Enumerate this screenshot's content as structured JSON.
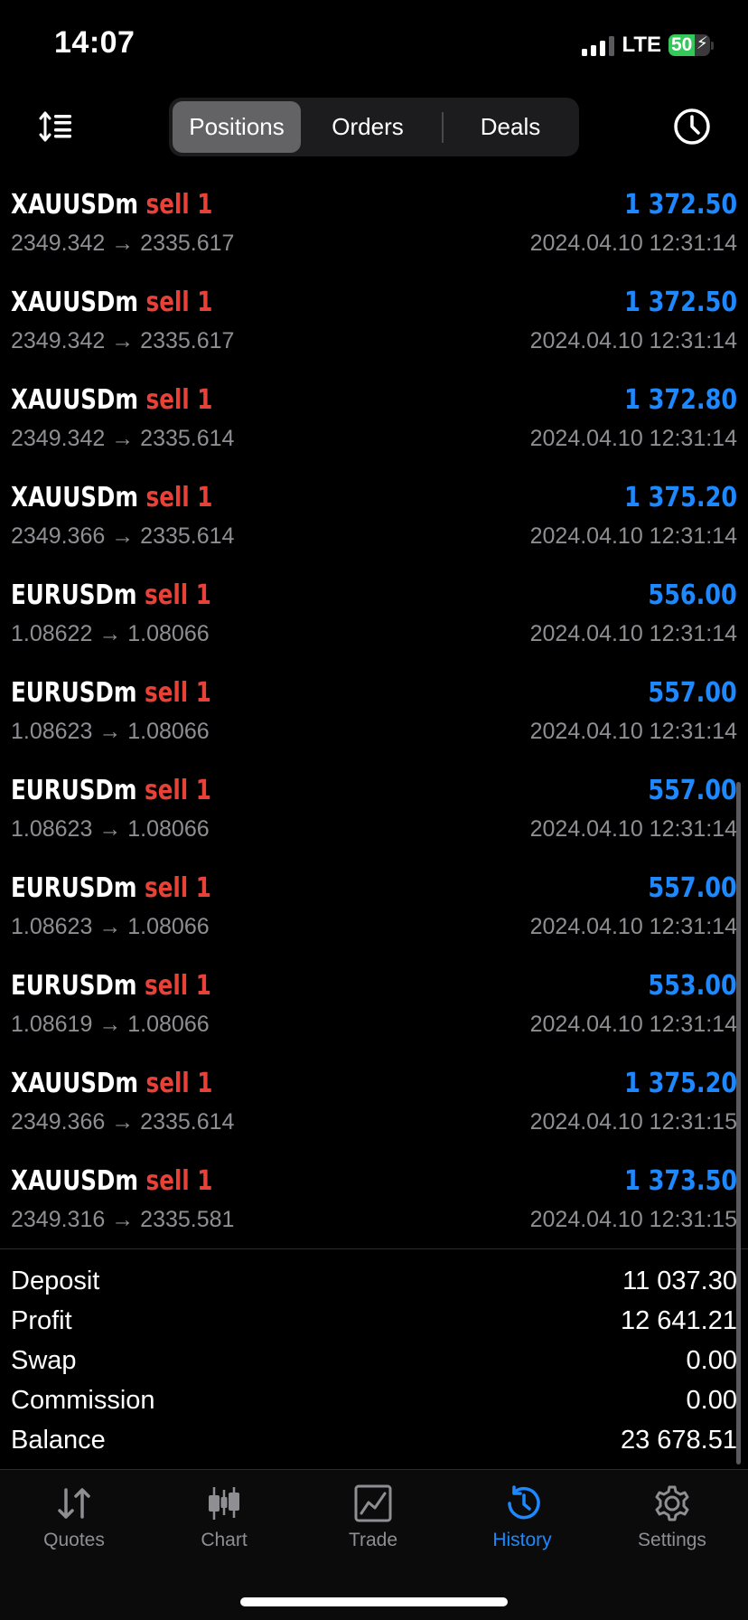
{
  "status_bar": {
    "time": "14:07",
    "network": "LTE",
    "battery": "50"
  },
  "header": {
    "tabs": [
      {
        "label": "Positions",
        "active": true
      },
      {
        "label": "Orders",
        "active": false
      },
      {
        "label": "Deals",
        "active": false
      }
    ],
    "icons": [
      "sort-icon",
      "clock-icon"
    ]
  },
  "deals": [
    {
      "symbol": "XAUUSDm",
      "side": "sell 1",
      "price": "2349.342 → 2335.617",
      "profit": "1 372.50",
      "time": "2024.04.10 12:31:14"
    },
    {
      "symbol": "XAUUSDm",
      "side": "sell 1",
      "price": "2349.342 → 2335.617",
      "profit": "1 372.50",
      "time": "2024.04.10 12:31:14"
    },
    {
      "symbol": "XAUUSDm",
      "side": "sell 1",
      "price": "2349.342 → 2335.614",
      "profit": "1 372.80",
      "time": "2024.04.10 12:31:14"
    },
    {
      "symbol": "XAUUSDm",
      "side": "sell 1",
      "price": "2349.366 → 2335.614",
      "profit": "1 375.20",
      "time": "2024.04.10 12:31:14"
    },
    {
      "symbol": "EURUSDm",
      "side": "sell 1",
      "price": "1.08622 → 1.08066",
      "profit": "556.00",
      "time": "2024.04.10 12:31:14"
    },
    {
      "symbol": "EURUSDm",
      "side": "sell 1",
      "price": "1.08623 → 1.08066",
      "profit": "557.00",
      "time": "2024.04.10 12:31:14"
    },
    {
      "symbol": "EURUSDm",
      "side": "sell 1",
      "price": "1.08623 → 1.08066",
      "profit": "557.00",
      "time": "2024.04.10 12:31:14"
    },
    {
      "symbol": "EURUSDm",
      "side": "sell 1",
      "price": "1.08623 → 1.08066",
      "profit": "557.00",
      "time": "2024.04.10 12:31:14"
    },
    {
      "symbol": "EURUSDm",
      "side": "sell 1",
      "price": "1.08619 → 1.08066",
      "profit": "553.00",
      "time": "2024.04.10 12:31:14"
    },
    {
      "symbol": "XAUUSDm",
      "side": "sell 1",
      "price": "2349.366 → 2335.614",
      "profit": "1 375.20",
      "time": "2024.04.10 12:31:15"
    },
    {
      "symbol": "XAUUSDm",
      "side": "sell 1",
      "price": "2349.316 → 2335.581",
      "profit": "1 373.50",
      "time": "2024.04.10 12:31:15"
    }
  ],
  "summary": [
    {
      "label": "Deposit",
      "value": "11 037.30"
    },
    {
      "label": "Profit",
      "value": "12 641.21"
    },
    {
      "label": "Swap",
      "value": "0.00"
    },
    {
      "label": "Commission",
      "value": "0.00"
    },
    {
      "label": "Balance",
      "value": "23 678.51"
    }
  ],
  "tabbar": [
    {
      "label": "Quotes",
      "icon": "quotes-icon",
      "active": false
    },
    {
      "label": "Chart",
      "icon": "chart-icon",
      "active": false
    },
    {
      "label": "Trade",
      "icon": "trade-icon",
      "active": false
    },
    {
      "label": "History",
      "icon": "history-icon",
      "active": true
    },
    {
      "label": "Settings",
      "icon": "settings-icon",
      "active": false
    }
  ],
  "colors": {
    "background": "#000000",
    "sell": "#e84238",
    "profit": "#1e88ff",
    "muted": "#8e8e93",
    "active_tab": "#1e88ff"
  }
}
